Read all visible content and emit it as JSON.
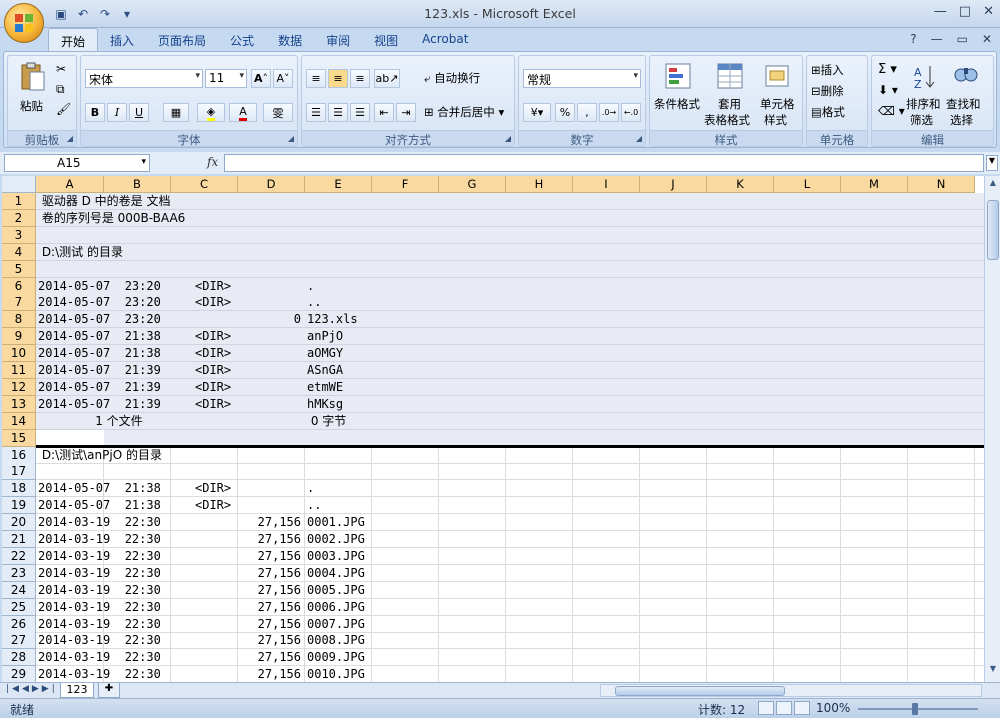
{
  "window": {
    "title": "123.xls - Microsoft Excel",
    "controls": [
      "—",
      "□",
      "✕"
    ]
  },
  "ribbon_tabs": [
    "开始",
    "插入",
    "页面布局",
    "公式",
    "数据",
    "审阅",
    "视图",
    "Acrobat"
  ],
  "ribbon": {
    "clipboard": {
      "label": "剪贴板",
      "paste": "粘贴"
    },
    "font": {
      "label": "字体",
      "font_name": "宋体",
      "font_size": "11",
      "bold": "B",
      "italic": "I",
      "underline": "U",
      "grow": "A",
      "shrink": "A"
    },
    "alignment": {
      "label": "对齐方式",
      "wrap_text": "自动换行",
      "merge_center": "合并后居中"
    },
    "number": {
      "label": "数字",
      "format": "常规",
      "percent": "%",
      "comma": ","
    },
    "styles": {
      "label": "样式",
      "conditional": "条件格式",
      "table_line1": "套用",
      "table_line2": "表格格式",
      "cell_line1": "单元格",
      "cell_line2": "样式"
    },
    "cells": {
      "label": "单元格",
      "insert": "插入",
      "delete": "删除",
      "format": "格式"
    },
    "editing": {
      "label": "编辑",
      "sort_line1": "排序和",
      "sort_line2": "筛选",
      "find_line1": "查找和",
      "find_line2": "选择"
    }
  },
  "formula_bar": {
    "name_box": "A15",
    "fx": "fx",
    "formula": ""
  },
  "columns": [
    "A",
    "B",
    "C",
    "D",
    "E",
    "F",
    "G",
    "H",
    "I",
    "J",
    "K",
    "L",
    "M",
    "N"
  ],
  "rows": [
    {
      "n": "1",
      "a": " 驱动器 D 中的卷是 文档",
      "c": "",
      "d": "",
      "e": ""
    },
    {
      "n": "2",
      "a": " 卷的序列号是 000B-BAA6",
      "c": "",
      "d": "",
      "e": ""
    },
    {
      "n": "3",
      "a": "",
      "c": "",
      "d": "",
      "e": ""
    },
    {
      "n": "4",
      "a": " D:\\测试 的目录",
      "c": "",
      "d": "",
      "e": ""
    },
    {
      "n": "5",
      "a": "",
      "c": "",
      "d": "",
      "e": ""
    },
    {
      "n": "6",
      "a": "2014-05-07  23:20",
      "c": "<DIR>",
      "d": "",
      "e": "."
    },
    {
      "n": "7",
      "a": "2014-05-07  23:20",
      "c": "<DIR>",
      "d": "",
      "e": ".."
    },
    {
      "n": "8",
      "a": "2014-05-07  23:20",
      "c": "",
      "d": "0",
      "e": "123.xls"
    },
    {
      "n": "9",
      "a": "2014-05-07  21:38",
      "c": "<DIR>",
      "d": "",
      "e": "anPjO"
    },
    {
      "n": "10",
      "a": "2014-05-07  21:38",
      "c": "<DIR>",
      "d": "",
      "e": "aOMGY"
    },
    {
      "n": "11",
      "a": "2014-05-07  21:39",
      "c": "<DIR>",
      "d": "",
      "e": "ASnGA"
    },
    {
      "n": "12",
      "a": "2014-05-07  21:39",
      "c": "<DIR>",
      "d": "",
      "e": "etmWE"
    },
    {
      "n": "13",
      "a": "2014-05-07  21:39",
      "c": "<DIR>",
      "d": "",
      "e": "hMKsg"
    },
    {
      "n": "14",
      "a": "               1 个文件",
      "c": "",
      "d": "",
      "e": " 0 字节"
    },
    {
      "n": "15",
      "a": "",
      "c": "",
      "d": "",
      "e": ""
    },
    {
      "n": "16",
      "a": " D:\\测试\\anPjO 的目录",
      "c": "",
      "d": "",
      "e": ""
    },
    {
      "n": "17",
      "a": "",
      "c": "",
      "d": "",
      "e": ""
    },
    {
      "n": "18",
      "a": "2014-05-07  21:38",
      "c": "<DIR>",
      "d": "",
      "e": "."
    },
    {
      "n": "19",
      "a": "2014-05-07  21:38",
      "c": "<DIR>",
      "d": "",
      "e": ".."
    },
    {
      "n": "20",
      "a": "2014-03-19  22:30",
      "c": "",
      "d": "27,156",
      "e": "0001.JPG"
    },
    {
      "n": "21",
      "a": "2014-03-19  22:30",
      "c": "",
      "d": "27,156",
      "e": "0002.JPG"
    },
    {
      "n": "22",
      "a": "2014-03-19  22:30",
      "c": "",
      "d": "27,156",
      "e": "0003.JPG"
    },
    {
      "n": "23",
      "a": "2014-03-19  22:30",
      "c": "",
      "d": "27,156",
      "e": "0004.JPG"
    },
    {
      "n": "24",
      "a": "2014-03-19  22:30",
      "c": "",
      "d": "27,156",
      "e": "0005.JPG"
    },
    {
      "n": "25",
      "a": "2014-03-19  22:30",
      "c": "",
      "d": "27,156",
      "e": "0006.JPG"
    },
    {
      "n": "26",
      "a": "2014-03-19  22:30",
      "c": "",
      "d": "27,156",
      "e": "0007.JPG"
    },
    {
      "n": "27",
      "a": "2014-03-19  22:30",
      "c": "",
      "d": "27,156",
      "e": "0008.JPG"
    },
    {
      "n": "28",
      "a": "2014-03-19  22:30",
      "c": "",
      "d": "27,156",
      "e": "0009.JPG"
    },
    {
      "n": "29",
      "a": "2014-03-19  22:30",
      "c": "",
      "d": "27,156",
      "e": "0010.JPG"
    }
  ],
  "sheet_tab": "123",
  "status": {
    "ready": "就绪",
    "count": "计数: 12",
    "zoom": "100%"
  },
  "colors": {
    "header_selected": "#f9d99f",
    "selection_fill": "#e9ebf4",
    "ribbon_bg": "#dbe6f4"
  }
}
